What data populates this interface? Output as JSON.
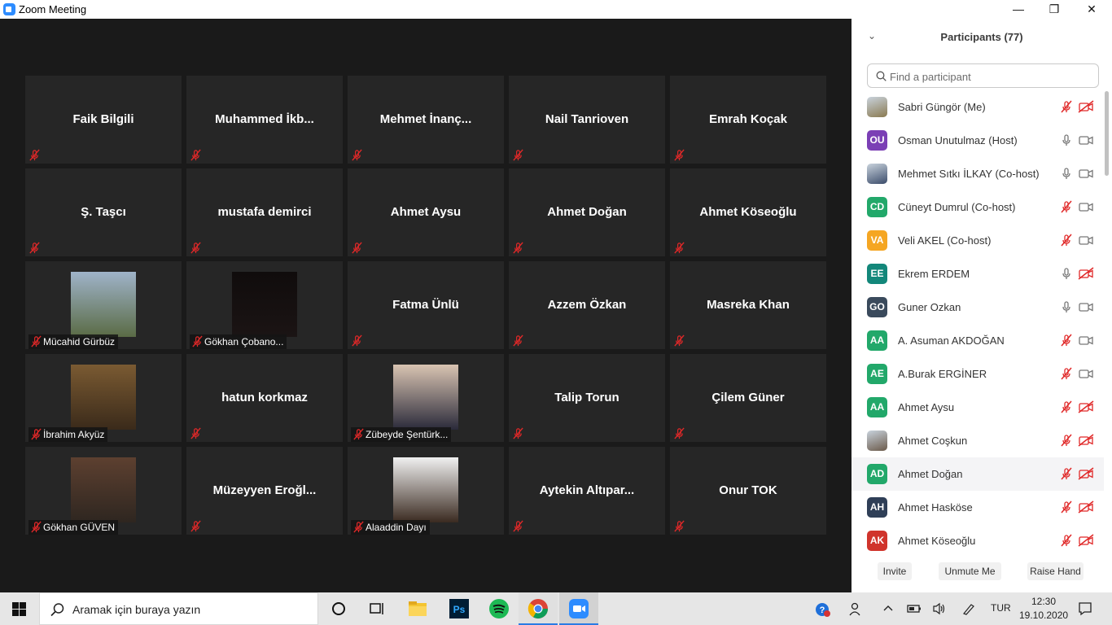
{
  "window": {
    "title": "Zoom Meeting",
    "minimize_glyph": "—",
    "maximize_glyph": "❐",
    "close_glyph": "✕"
  },
  "video_tiles": [
    {
      "name": "Faik Bilgili",
      "photo": false
    },
    {
      "name": "Muhammed  İkb...",
      "photo": false
    },
    {
      "name": "Mehmet  İnanç...",
      "photo": false
    },
    {
      "name": "Nail Tanrioven",
      "photo": false
    },
    {
      "name": "Emrah Koçak",
      "photo": false
    },
    {
      "name": "Ş. Taşcı",
      "photo": false
    },
    {
      "name": "mustafa demirci",
      "photo": false
    },
    {
      "name": "Ahmet Aysu",
      "photo": false
    },
    {
      "name": "Ahmet Doğan",
      "photo": false
    },
    {
      "name": "Ahmet Köseoğlu",
      "photo": false
    },
    {
      "name": "Mücahid Gürbüz",
      "photo": true,
      "photo_colors": [
        "#9fb3c9",
        "#5a6b45"
      ]
    },
    {
      "name": "Gökhan Çobano...",
      "photo": true,
      "photo_colors": [
        "#100c0c",
        "#1b1414"
      ]
    },
    {
      "name": "Fatma Ünlü",
      "photo": false
    },
    {
      "name": "Azzem Özkan",
      "photo": false
    },
    {
      "name": "Masreka Khan",
      "photo": false
    },
    {
      "name": "İbrahim Akyüz",
      "photo": true,
      "photo_colors": [
        "#7a5a32",
        "#3a2a1a"
      ]
    },
    {
      "name": "hatun korkmaz",
      "photo": false
    },
    {
      "name": "Zübeyde Şentürk...",
      "photo": true,
      "photo_colors": [
        "#d9c4b2",
        "#2a2a3a"
      ]
    },
    {
      "name": "Talip Torun",
      "photo": false
    },
    {
      "name": "Çilem Güner",
      "photo": false
    },
    {
      "name": "Gökhan GÜVEN",
      "photo": true,
      "photo_colors": [
        "#5d4030",
        "#2e2620"
      ]
    },
    {
      "name": "Müzeyyen  Eroğl...",
      "photo": false
    },
    {
      "name": "Alaaddin Dayı",
      "photo": true,
      "photo_colors": [
        "#f0f0f0",
        "#3a2a20"
      ]
    },
    {
      "name": "Aytekin  Altıpar...",
      "photo": false
    },
    {
      "name": "Onur TOK",
      "photo": false
    }
  ],
  "panel": {
    "title": "Participants (77)",
    "collapse_glyph": "⌄",
    "search_placeholder": "Find a participant",
    "participants": [
      {
        "name": "Sabri Güngör (Me)",
        "initials": "",
        "color": "#8a7a50",
        "mic_muted": true,
        "cam_off": true,
        "image": true
      },
      {
        "name": "Osman Unutulmaz (Host)",
        "initials": "OU",
        "color": "#7b3fb5",
        "mic_muted": false,
        "cam_off": false
      },
      {
        "name": "Mehmet Sıtkı İLKAY (Co-host)",
        "initials": "",
        "color": "#3b4c6b",
        "mic_muted": false,
        "cam_off": false,
        "image": true
      },
      {
        "name": "Cüneyt Dumrul (Co-host)",
        "initials": "CD",
        "color": "#22a86a",
        "mic_muted": true,
        "cam_off": false
      },
      {
        "name": "Veli AKEL (Co-host)",
        "initials": "VA",
        "color": "#f5a623",
        "mic_muted": true,
        "cam_off": false
      },
      {
        "name": "Ekrem ERDEM",
        "initials": "EE",
        "color": "#13877a",
        "mic_muted": false,
        "cam_off": true
      },
      {
        "name": "Guner Ozkan",
        "initials": "GO",
        "color": "#3a4a5c",
        "mic_muted": false,
        "cam_off": false
      },
      {
        "name": "A. Asuman AKDOĞAN",
        "initials": "AA",
        "color": "#22a86a",
        "mic_muted": true,
        "cam_off": false
      },
      {
        "name": "A.Burak ERGİNER",
        "initials": "AE",
        "color": "#22a86a",
        "mic_muted": true,
        "cam_off": false
      },
      {
        "name": "Ahmet Aysu",
        "initials": "AA",
        "color": "#22a86a",
        "mic_muted": true,
        "cam_off": true
      },
      {
        "name": "Ahmet Coşkun",
        "initials": "",
        "color": "#6b5a4a",
        "mic_muted": true,
        "cam_off": true,
        "image": true
      },
      {
        "name": "Ahmet Doğan",
        "initials": "AD",
        "color": "#22a86a",
        "mic_muted": true,
        "cam_off": true,
        "highlight": true
      },
      {
        "name": "Ahmet Hasköse",
        "initials": "AH",
        "color": "#2f3f57",
        "mic_muted": true,
        "cam_off": true
      },
      {
        "name": "Ahmet Köseoğlu",
        "initials": "AK",
        "color": "#d0342c",
        "mic_muted": true,
        "cam_off": true
      }
    ],
    "buttons": {
      "invite": "Invite",
      "unmute": "Unmute Me",
      "raise_hand": "Raise Hand"
    }
  },
  "taskbar": {
    "search_text": "Aramak için buraya yazın",
    "language": "TUR",
    "time": "12:30",
    "date": "19.10.2020",
    "apps": [
      "start-icon",
      "cortana-icon",
      "task-view-icon",
      "file-explorer-icon",
      "photoshop-icon",
      "spotify-icon",
      "chrome-icon",
      "zoom-icon"
    ],
    "photoshop_label": "Ps"
  },
  "colors": {
    "mute_red": "#e02828",
    "accent": "#2d8cff",
    "tile_bg": "#262626"
  }
}
